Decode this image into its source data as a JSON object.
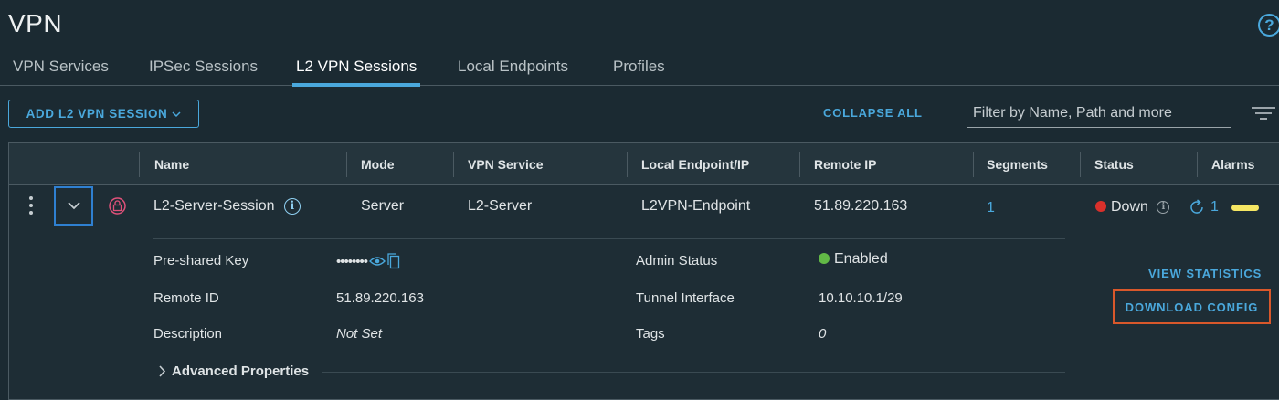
{
  "page": {
    "title": "VPN"
  },
  "tabs": [
    {
      "label": "VPN Services"
    },
    {
      "label": "IPSec Sessions"
    },
    {
      "label": "L2 VPN Sessions",
      "active": true
    },
    {
      "label": "Local Endpoints"
    },
    {
      "label": "Profiles"
    }
  ],
  "toolbar": {
    "add_label": "ADD L2 VPN SESSION",
    "collapse_label": "COLLAPSE ALL",
    "filter_placeholder": "Filter by Name, Path and more"
  },
  "table": {
    "columns": [
      "Name",
      "Mode",
      "VPN Service",
      "Local Endpoint/IP",
      "Remote IP",
      "Segments",
      "Status",
      "Alarms"
    ],
    "row": {
      "name": "L2-Server-Session",
      "mode": "Server",
      "vpn_service": "L2-Server",
      "local_endpoint": "L2VPN-Endpoint",
      "remote_ip": "51.89.220.163",
      "segments": "1",
      "status": "Down",
      "alarms": "1"
    },
    "details": {
      "psk_label": "Pre-shared Key",
      "psk_value": "••••••••",
      "remote_id_label": "Remote ID",
      "remote_id_value": "51.89.220.163",
      "description_label": "Description",
      "description_value": "Not Set",
      "admin_status_label": "Admin Status",
      "admin_status_value": "Enabled",
      "tunnel_label": "Tunnel Interface",
      "tunnel_value": "10.10.10.1/29",
      "tags_label": "Tags",
      "tags_value": "0",
      "advanced_label": "Advanced Properties"
    },
    "actions": {
      "view_stats": "VIEW STATISTICS",
      "download_config": "DOWNLOAD CONFIG"
    }
  },
  "colors": {
    "accent": "#4aa8dc",
    "status_down": "#d9302b",
    "status_enabled": "#62b946",
    "alarm": "#f5e663",
    "highlight": "#d9582b"
  }
}
